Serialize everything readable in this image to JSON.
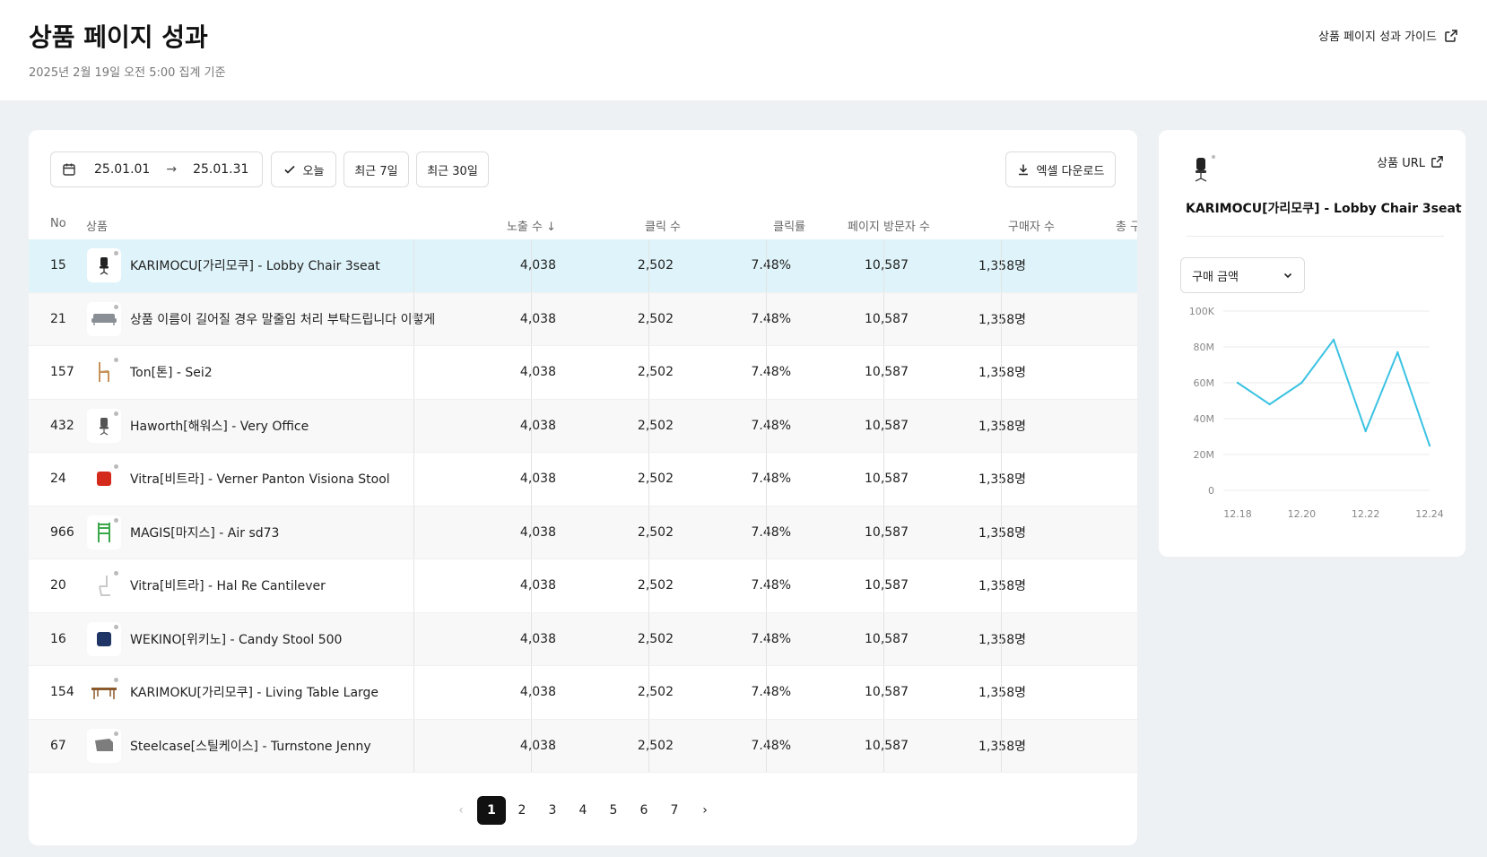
{
  "header": {
    "title": "상품 페이지 성과",
    "subtitle": "2025년 2월 19일 오전 5:00 집계 기준",
    "guide_label": "상품 페이지 성과 가이드"
  },
  "toolbar": {
    "date_from": "25.01.01",
    "date_arrow": "→",
    "date_to": "25.01.31",
    "today_label": "오늘",
    "last7_label": "최근 7일",
    "last30_label": "최근 30일",
    "excel_label": "엑셀 다운로드"
  },
  "columns": {
    "no": "No",
    "product": "상품",
    "impressions": "노출 수 ↓",
    "clicks": "클릭 수",
    "ctr": "클릭률",
    "visitors": "페이지 방문자 수",
    "buyers": "구매자 수",
    "total": "총 구"
  },
  "rows": [
    {
      "no": "15",
      "name": "KARIMOCU[가리모쿠] - Lobby Chair 3seat",
      "impressions": "4,038",
      "clicks": "2,502",
      "ctr": "7.48%",
      "visitors": "10,587",
      "buyers": "1,358명",
      "icon": "office-chair-icon",
      "color": "#222222"
    },
    {
      "no": "21",
      "name": "상품 이름이 길어질 경우 말줄임 처리 부탁드립니다 이렇게요...",
      "impressions": "4,038",
      "clicks": "2,502",
      "ctr": "7.48%",
      "visitors": "10,587",
      "buyers": "1,358명",
      "icon": "sofa-icon",
      "color": "#8a8f96"
    },
    {
      "no": "157",
      "name": "Ton[톤] - Sei2",
      "impressions": "4,038",
      "clicks": "2,502",
      "ctr": "7.48%",
      "visitors": "10,587",
      "buyers": "1,358명",
      "icon": "wooden-chair-icon",
      "color": "#c8935a"
    },
    {
      "no": "432",
      "name": "Haworth[해워스] - Very Office",
      "impressions": "4,038",
      "clicks": "2,502",
      "ctr": "7.48%",
      "visitors": "10,587",
      "buyers": "1,358명",
      "icon": "office-chair-icon",
      "color": "#555555"
    },
    {
      "no": "24",
      "name": "Vitra[비트라] - Verner Panton Visiona Stool",
      "impressions": "4,038",
      "clicks": "2,502",
      "ctr": "7.48%",
      "visitors": "10,587",
      "buyers": "1,358명",
      "icon": "stool-icon",
      "color": "#d42a1c"
    },
    {
      "no": "966",
      "name": "MAGIS[마지스] - Air sd73",
      "impressions": "4,038",
      "clicks": "2,502",
      "ctr": "7.48%",
      "visitors": "10,587",
      "buyers": "1,358명",
      "icon": "chair-icon",
      "color": "#3aa84a"
    },
    {
      "no": "20",
      "name": "Vitra[비트라] - Hal Re Cantilever",
      "impressions": "4,038",
      "clicks": "2,502",
      "ctr": "7.48%",
      "visitors": "10,587",
      "buyers": "1,358명",
      "icon": "cantilever-chair-icon",
      "color": "#c9c9c9"
    },
    {
      "no": "16",
      "name": "WEKINO[위키노] - Candy Stool 500",
      "impressions": "4,038",
      "clicks": "2,502",
      "ctr": "7.48%",
      "visitors": "10,587",
      "buyers": "1,358명",
      "icon": "stool-icon",
      "color": "#1f3566"
    },
    {
      "no": "154",
      "name": "KARIMOKU[가리모쿠] - Living Table Large",
      "impressions": "4,038",
      "clicks": "2,502",
      "ctr": "7.48%",
      "visitors": "10,587",
      "buyers": "1,358명",
      "icon": "table-icon",
      "color": "#8a5a2c"
    },
    {
      "no": "67",
      "name": "Steelcase[스틸케이스] - Turnstone Jenny",
      "impressions": "4,038",
      "clicks": "2,502",
      "ctr": "7.48%",
      "visitors": "10,587",
      "buyers": "1,358명",
      "icon": "lounge-chair-icon",
      "color": "#7d7d7d"
    }
  ],
  "selected_row": 0,
  "pagination": {
    "pages": [
      "1",
      "2",
      "3",
      "4",
      "5",
      "6",
      "7"
    ],
    "current": "1",
    "prev_icon": "chevron-left-icon",
    "next_icon": "chevron-right-icon"
  },
  "side": {
    "url_label": "상품 URL",
    "product_name": "KARIMOCU[가리모쿠] - Lobby Chair 3seat",
    "metric_select": "구매 금액"
  },
  "colors": {
    "accent_line": "#3cc3e2",
    "selected_row": "#dff4fa"
  },
  "chart_data": {
    "type": "line",
    "title": "",
    "xlabel": "",
    "ylabel": "",
    "x_tick_labels": [
      "12.18",
      "12.20",
      "12.22",
      "12.24"
    ],
    "y_tick_labels": [
      "0",
      "20M",
      "40M",
      "60M",
      "80M",
      "100K"
    ],
    "y_ticks": [
      0,
      20,
      40,
      60,
      80,
      100
    ],
    "ylim": [
      0,
      100
    ],
    "x_index_range": [
      0,
      6
    ],
    "series": [
      {
        "values": [
          60,
          48,
          60,
          84,
          33,
          77,
          25
        ]
      }
    ],
    "grid": true,
    "legend": "none"
  }
}
